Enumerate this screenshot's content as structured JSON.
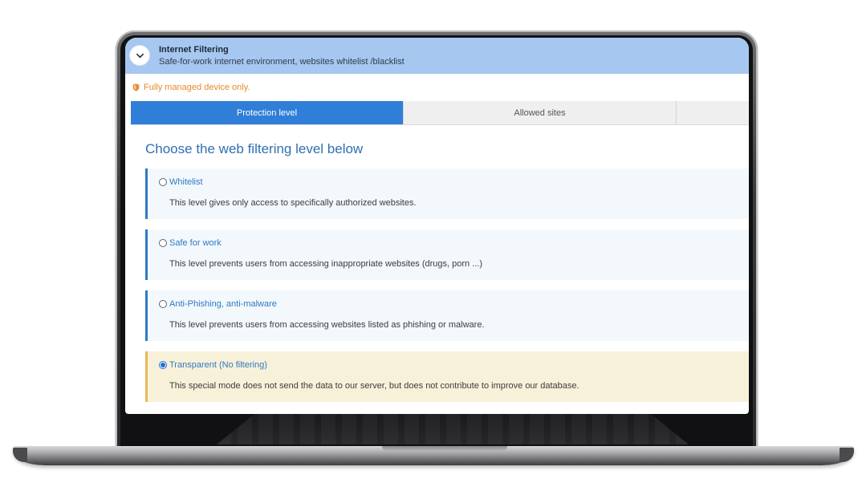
{
  "header": {
    "title": "Internet Filtering",
    "subtitle": "Safe-for-work internet environment, websites whitelist /blacklist"
  },
  "notice": "Fully managed device only.",
  "tabs": [
    {
      "label": "Protection level",
      "active": true
    },
    {
      "label": "Allowed sites",
      "active": false
    },
    {
      "label": "",
      "active": false
    }
  ],
  "section_title": "Choose the web filtering level below",
  "options": [
    {
      "label": "Whitelist",
      "description": "This level gives only access to specifically authorized websites.",
      "selected": false
    },
    {
      "label": "Safe for work",
      "description": "This level prevents users from accessing inappropriate websites (drugs, porn ...)",
      "selected": false
    },
    {
      "label": "Anti-Phishing, anti-malware",
      "description": "This level prevents users from accessing websites listed as phishing or malware.",
      "selected": false
    },
    {
      "label": "Transparent (No filtering)",
      "description": "This special mode does not send the data to our server, but does not contribute to improve our database.",
      "selected": true
    }
  ],
  "colors": {
    "header_bg": "#a6c7ef",
    "accent": "#2f7ed8",
    "notice": "#e8892b",
    "option_bg": "#f3f8fc",
    "selected_bg": "#f8f1d9",
    "selected_border": "#e9b75a"
  }
}
